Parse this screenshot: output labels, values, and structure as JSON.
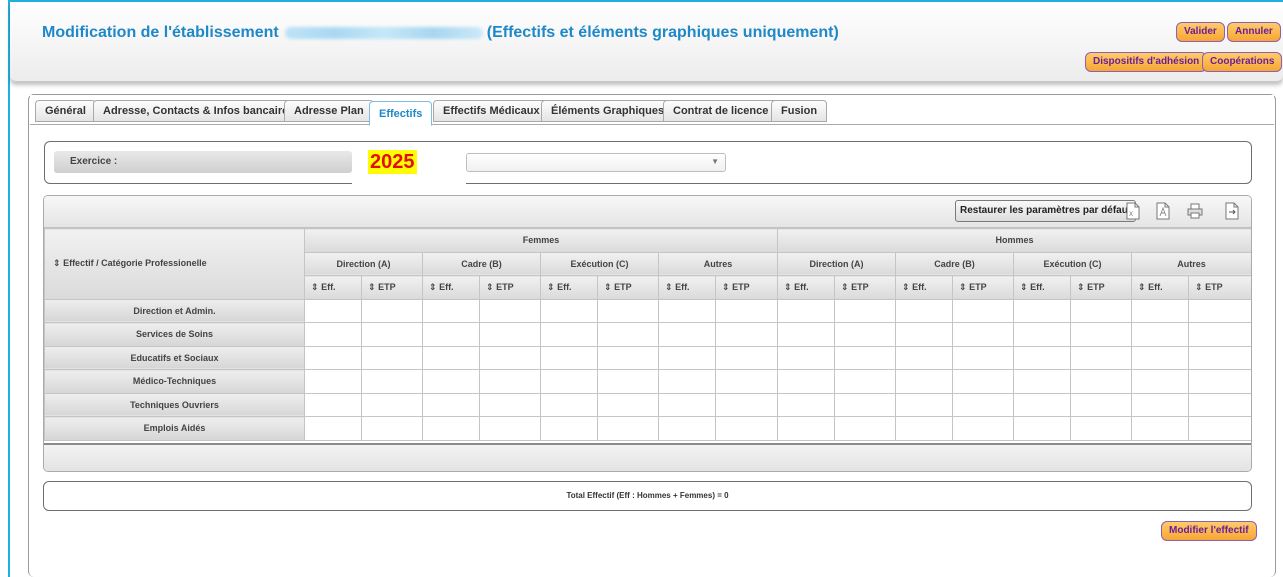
{
  "header": {
    "title_prefix": "Modification de l'établissement",
    "title_suffix": "(Effectifs et éléments graphiques uniquement)",
    "buttons": {
      "valider": "Valider",
      "annuler": "Annuler",
      "dispositifs": "Dispositifs d'adhésion",
      "cooperations": "Coopérations"
    }
  },
  "tabs": [
    {
      "label": "Général",
      "active": false
    },
    {
      "label": "Adresse, Contacts & Infos bancaires",
      "active": false
    },
    {
      "label": "Adresse Plan",
      "active": false
    },
    {
      "label": "Effectifs",
      "active": true
    },
    {
      "label": "Effectifs Médicaux",
      "active": false
    },
    {
      "label": "Éléments Graphiques",
      "active": false
    },
    {
      "label": "Contrat de licence",
      "active": false
    },
    {
      "label": "Fusion",
      "active": false
    }
  ],
  "exercice": {
    "label": "Exercice :",
    "year": "2025",
    "select_value": ""
  },
  "grid": {
    "restore_label": "Restaurer les paramètres par défaut",
    "category_header": "Effectif / Catégorie Professionelle",
    "groups": [
      "Femmes",
      "Hommes"
    ],
    "subgroups": [
      "Direction (A)",
      "Cadre (B)",
      "Exécution (C)",
      "Autres"
    ],
    "cols": [
      "Eff.",
      "ETP"
    ],
    "sort_glyph": "⇕",
    "rows": [
      "Direction et Admin.",
      "Services de Soins",
      "Educatifs et Sociaux",
      "Médico-Techniques",
      "Techniques Ouvriers",
      "Emplois Aidés"
    ]
  },
  "total": {
    "text": "Total Effectif (Eff : Hommes + Femmes) = 0"
  },
  "modify_label": "Modifier l'effectif",
  "colors": {
    "accent": "#1e88c8",
    "button_orange": "#f7a633",
    "button_text": "#6a1e9a",
    "year_highlight": "#fffd00",
    "year_text": "#e01010"
  },
  "icons": [
    "excel-export-icon",
    "pdf-export-icon",
    "print-icon",
    "export-icon"
  ]
}
